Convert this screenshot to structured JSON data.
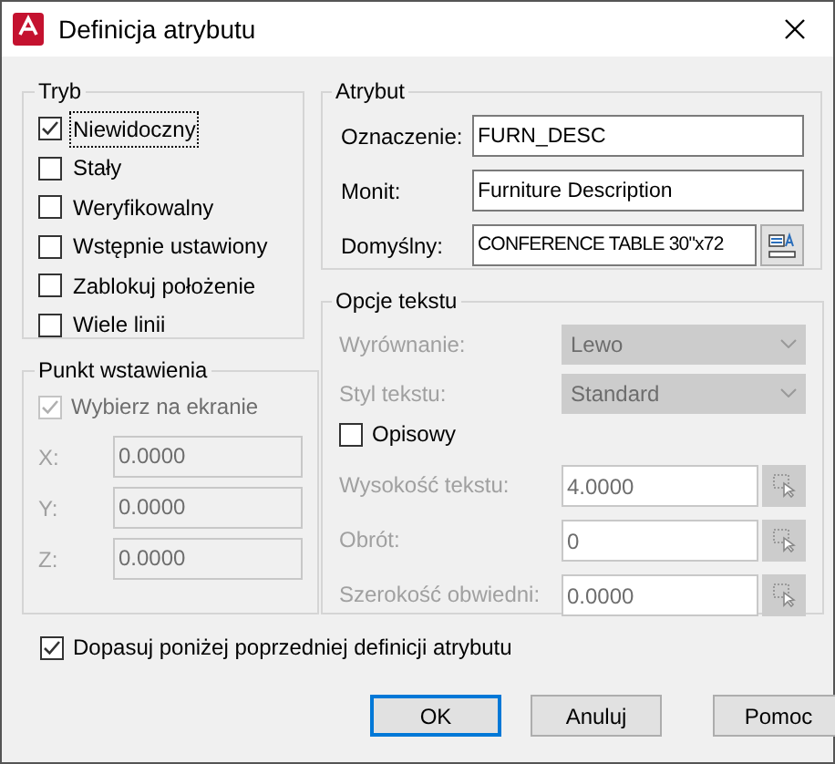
{
  "window": {
    "title": "Definicja atrybutu"
  },
  "mode": {
    "title": "Tryb",
    "options": [
      {
        "label": "Niewidoczny",
        "checked": true,
        "focused": true
      },
      {
        "label": "Stały",
        "checked": false,
        "focused": false
      },
      {
        "label": "Weryfikowalny",
        "checked": false,
        "focused": false
      },
      {
        "label": "Wstępnie ustawiony",
        "checked": false,
        "focused": false
      },
      {
        "label": "Zablokuj położenie",
        "checked": false,
        "focused": false
      },
      {
        "label": "Wiele linii",
        "checked": false,
        "focused": false
      }
    ]
  },
  "insertion_point": {
    "title": "Punkt wstawienia",
    "pick": {
      "label": "Wybierz na ekranie",
      "checked": true,
      "disabled": true
    },
    "coords": [
      {
        "label": "X:",
        "value": "0.0000",
        "disabled": true
      },
      {
        "label": "Y:",
        "value": "0.0000",
        "disabled": true
      },
      {
        "label": "Z:",
        "value": "0.0000",
        "disabled": true
      }
    ]
  },
  "attribute": {
    "title": "Atrybut",
    "fields": [
      {
        "label": "Oznaczenie:",
        "value": "FURN_DESC",
        "has_button": false
      },
      {
        "label": "Monit:",
        "value": "Furniture Description",
        "has_button": false
      },
      {
        "label": "Domyślny:",
        "value": "CONFERENCE TABLE 30\"x72",
        "has_button": true
      }
    ]
  },
  "text_options": {
    "title": "Opcje tekstu",
    "rows": [
      {
        "kind": "dropdown",
        "label": "Wyrównanie:",
        "value": "Lewo",
        "disabled": true
      },
      {
        "kind": "dropdown",
        "label": "Styl tekstu:",
        "value": "Standard",
        "disabled": true
      },
      {
        "kind": "checkbox",
        "label": "Opisowy",
        "checked": false,
        "disabled": false
      },
      {
        "kind": "pick",
        "label": "Wysokość tekstu:",
        "value": "4.0000",
        "disabled": true
      },
      {
        "kind": "pick",
        "label": "Obrót:",
        "value": "0",
        "disabled": true
      },
      {
        "kind": "pick",
        "label": "Szerokość obwiedni:",
        "value": "0.0000",
        "disabled": true
      }
    ]
  },
  "align_below": {
    "label": "Dopasuj poniżej poprzedniej definicji atrybutu",
    "checked": true
  },
  "buttons": [
    {
      "label": "OK",
      "default": true
    },
    {
      "label": "Anuluj",
      "default": false
    },
    {
      "label": "Pomoc",
      "default": false
    }
  ]
}
